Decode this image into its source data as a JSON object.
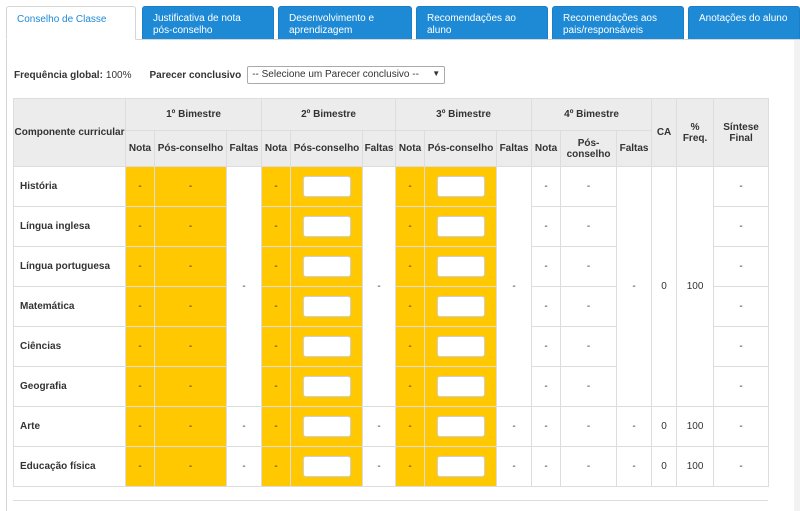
{
  "tabs": [
    {
      "label": "Conselho de Classe",
      "active": true
    },
    {
      "label": "Justificativa de nota pós-conselho",
      "active": false
    },
    {
      "label": "Desenvolvimento e aprendizagem",
      "active": false
    },
    {
      "label": "Recomendações ao aluno",
      "active": false
    },
    {
      "label": "Recomendações aos pais/responsáveis",
      "active": false
    },
    {
      "label": "Anotações do aluno",
      "active": false
    }
  ],
  "filters": {
    "freq_label": "Frequência global:",
    "freq_value": "100%",
    "parecer_label": "Parecer conclusivo",
    "parecer_select": "-- Selecione um Parecer conclusivo --"
  },
  "table": {
    "h_componente": "Componente curricular",
    "bimestres": [
      "1º Bimestre",
      "2º Bimestre",
      "3º Bimestre",
      "4º Bimestre"
    ],
    "h_nota": "Nota",
    "h_pos": "Pós-conselho",
    "h_faltas": "Faltas",
    "h_ca": "CA",
    "h_freq": "% Freq.",
    "h_sintese": "Síntese Final",
    "dash": "-",
    "merged": {
      "faltas": "-",
      "ca": "0",
      "freq": "100"
    },
    "rows": [
      {
        "name": "História"
      },
      {
        "name": "Língua inglesa"
      },
      {
        "name": "Língua portuguesa"
      },
      {
        "name": "Matemática"
      },
      {
        "name": "Ciências"
      },
      {
        "name": "Geografia"
      },
      {
        "name": "Arte",
        "faltas": "-",
        "ca": "0",
        "freq": "100"
      },
      {
        "name": "Educação física",
        "faltas": "-",
        "ca": "0",
        "freq": "100"
      }
    ]
  },
  "colors": {
    "tab_blue": "#1e8ad6",
    "grade_yellow": "#ffc800",
    "header_gray": "#ececec"
  }
}
